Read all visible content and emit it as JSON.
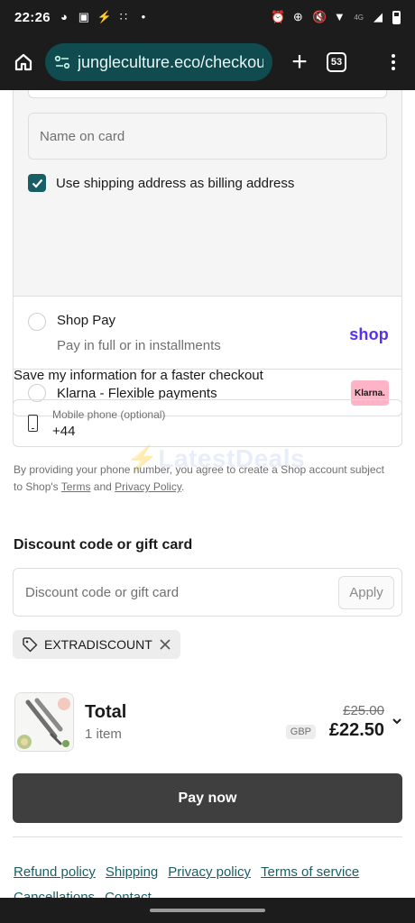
{
  "status_bar": {
    "time": "22:26",
    "network": "4G"
  },
  "browser": {
    "url": "jungleculture.eco/checkout",
    "tab_count": "53"
  },
  "card_fields": {
    "name_on_card_placeholder": "Name on card"
  },
  "billing": {
    "checked": true,
    "label": "Use shipping address as billing address"
  },
  "payment_options": {
    "shop_pay": {
      "title": "Shop Pay",
      "subtitle": "Pay in full or in installments",
      "logo": "shop"
    },
    "klarna": {
      "title": "Klarna - Flexible payments",
      "logo": "Klarna."
    }
  },
  "save_info": {
    "title": "Save my information for a faster checkout",
    "phone_label": "Mobile phone (optional)",
    "phone_value": "+44",
    "consent_prefix": "By providing your phone number, you agree to create a Shop account subject to Shop's ",
    "terms_link": "Terms",
    "consent_and": " and ",
    "privacy_link": "Privacy Policy",
    "consent_suffix": "."
  },
  "watermark": {
    "text": "LatestDeals"
  },
  "discount": {
    "title": "Discount code or gift card",
    "placeholder": "Discount code or gift card",
    "apply_label": "Apply",
    "applied_code": "EXTRADISCOUNT"
  },
  "summary": {
    "total_label": "Total",
    "items": "1 item",
    "original_price": "£25.00",
    "currency": "GBP",
    "price": "£22.50"
  },
  "pay_button": {
    "label": "Pay now"
  },
  "footer_links": [
    "Refund policy",
    "Shipping",
    "Privacy policy",
    "Terms of service",
    "Cancellations",
    "Contact"
  ],
  "colors": {
    "accent": "#1a5e65",
    "shop_pay": "#5a31f4",
    "klarna": "#ffb3c7",
    "pay_button": "#3f3f3f"
  }
}
